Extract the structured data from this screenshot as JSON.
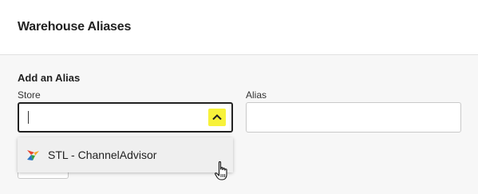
{
  "header": {
    "title": "Warehouse Aliases"
  },
  "form": {
    "section_title": "Add an Alias",
    "store": {
      "label": "Store",
      "value": "",
      "expanded": true
    },
    "alias": {
      "label": "Alias",
      "value": ""
    }
  },
  "dropdown": {
    "options": [
      {
        "label": "STL - ChannelAdvisor",
        "icon": "channeladvisor-logo-icon"
      }
    ]
  },
  "colors": {
    "chevron_highlight": "#f7f23a",
    "option_hover": "#efefef"
  }
}
